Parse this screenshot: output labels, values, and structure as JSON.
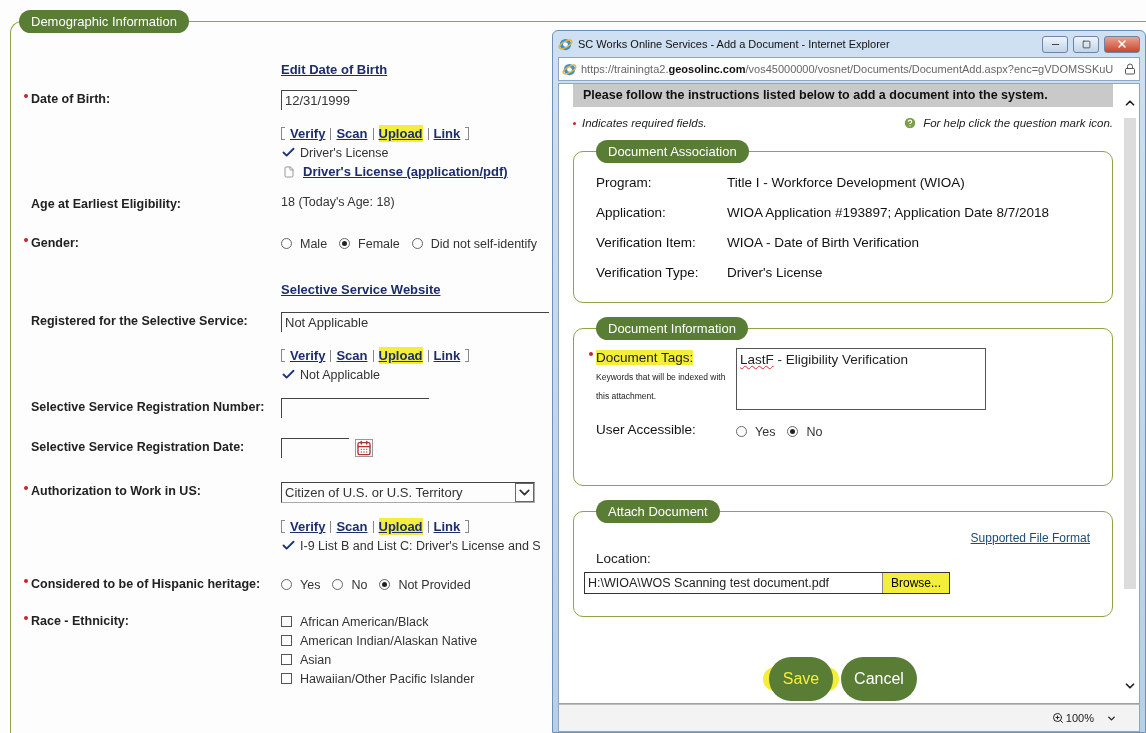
{
  "section_title": "Demographic Information",
  "rows": [
    {
      "kind": "link",
      "text": "Edit Date of Birth"
    },
    {
      "kind": "dateinput",
      "label": "Date of Birth:",
      "required": true,
      "value": "12/31/1999"
    },
    {
      "kind": "actions",
      "links": [
        {
          "label": "Verify",
          "highlighted": false
        },
        {
          "label": "Scan",
          "highlighted": false
        },
        {
          "label": "Upload",
          "highlighted": true
        },
        {
          "label": "Link",
          "highlighted": false
        }
      ],
      "verified": "Driver's License",
      "file": "Driver's License (application/pdf)"
    },
    {
      "kind": "static",
      "label": "Age at Earliest Eligibility:",
      "required": false,
      "value": "18 (Today's Age: 18)"
    },
    {
      "kind": "radio",
      "label": "Gender:",
      "required": true,
      "options": [
        {
          "label": "Male",
          "selected": false
        },
        {
          "label": "Female",
          "selected": true
        },
        {
          "label": "Did not self-identify",
          "selected": false
        }
      ]
    },
    {
      "kind": "link",
      "text": "Selective Service Website"
    },
    {
      "kind": "input",
      "label": "Registered for the Selective Service:",
      "required": false,
      "value": "Not Applicable"
    },
    {
      "kind": "actions",
      "links": [
        {
          "label": "Verify",
          "highlighted": false
        },
        {
          "label": "Scan",
          "highlighted": false
        },
        {
          "label": "Upload",
          "highlighted": true
        },
        {
          "label": "Link",
          "highlighted": false
        }
      ],
      "verified": "Not Applicable"
    },
    {
      "kind": "input",
      "label": "Selective Service Registration Number:",
      "required": false
    },
    {
      "kind": "date",
      "label": "Selective Service Registration Date:",
      "required": false
    },
    {
      "kind": "select",
      "label": "Authorization to Work in US:",
      "required": true,
      "value": "Citizen of U.S. or U.S. Territory"
    },
    {
      "kind": "actions",
      "links": [
        {
          "label": "Verify",
          "highlighted": false
        },
        {
          "label": "Scan",
          "highlighted": false
        },
        {
          "label": "Upload",
          "highlighted": true
        },
        {
          "label": "Link",
          "highlighted": false
        }
      ],
      "verified": "I-9 List B and List C: Driver's License and S"
    },
    {
      "kind": "radio",
      "label": "Considered to be of Hispanic heritage:",
      "required": true,
      "options": [
        {
          "label": "Yes",
          "selected": false
        },
        {
          "label": "No",
          "selected": false
        },
        {
          "label": "Not Provided",
          "selected": true
        }
      ]
    },
    {
      "kind": "checklist",
      "label": "Race - Ethnicity:",
      "required": true,
      "options": [
        {
          "label": "African American/Black",
          "checked": false
        },
        {
          "label": "American Indian/Alaskan Native",
          "checked": false
        },
        {
          "label": "Asian",
          "checked": false
        },
        {
          "label": "Hawaiian/Other Pacific Islander",
          "checked": false
        }
      ]
    }
  ],
  "popup": {
    "title": "SC Works Online Services - Add a Document - Internet Explorer",
    "url": "https://trainingta2.**geosolinc.com**/vos45000000/vosnet/Documents/DocumentAdd.aspx?enc=gVDOMSSKuU",
    "instructions": "Please follow the instructions listed below to add a document into the system.",
    "required_note": "Indicates required fields.",
    "help_note": "For help click the question mark icon.",
    "association": {
      "title": "Document Association",
      "rows": [
        {
          "label": "Program:",
          "value": "Title I - Workforce Development (WIOA)"
        },
        {
          "label": "Application:",
          "value": "WIOA Application #193897; Application Date 8/7/2018"
        },
        {
          "label": "Verification Item:",
          "value": "WIOA - Date of Birth Verification"
        },
        {
          "label": "Verification Type:",
          "value": "Driver's License"
        }
      ]
    },
    "information": {
      "title": "Document Information",
      "tags_label": "Document Tags:",
      "tags_highlighted": true,
      "tags_hint": "Keywords that will be indexed with this attachment.",
      "tags_value": [
        {
          "text": "LastF",
          "misspelled": true
        },
        {
          "text": " - Eligibility Verification",
          "misspelled": false
        }
      ],
      "accessible_label": "User Accessible:",
      "options": [
        {
          "label": "Yes",
          "selected": false
        },
        {
          "label": "No",
          "selected": true
        }
      ]
    },
    "attach": {
      "title": "Attach Document",
      "format_link": "Supported File Format",
      "location_label": "Location:",
      "location_value": "H:\\WIOA\\WOS Scanning test document.pdf",
      "browse": {
        "label": "Browse...",
        "highlighted": true
      }
    },
    "buttons": [
      {
        "label": "Save",
        "highlighted": true
      },
      {
        "label": "Cancel",
        "highlighted": false
      }
    ],
    "zoom": "100%"
  }
}
